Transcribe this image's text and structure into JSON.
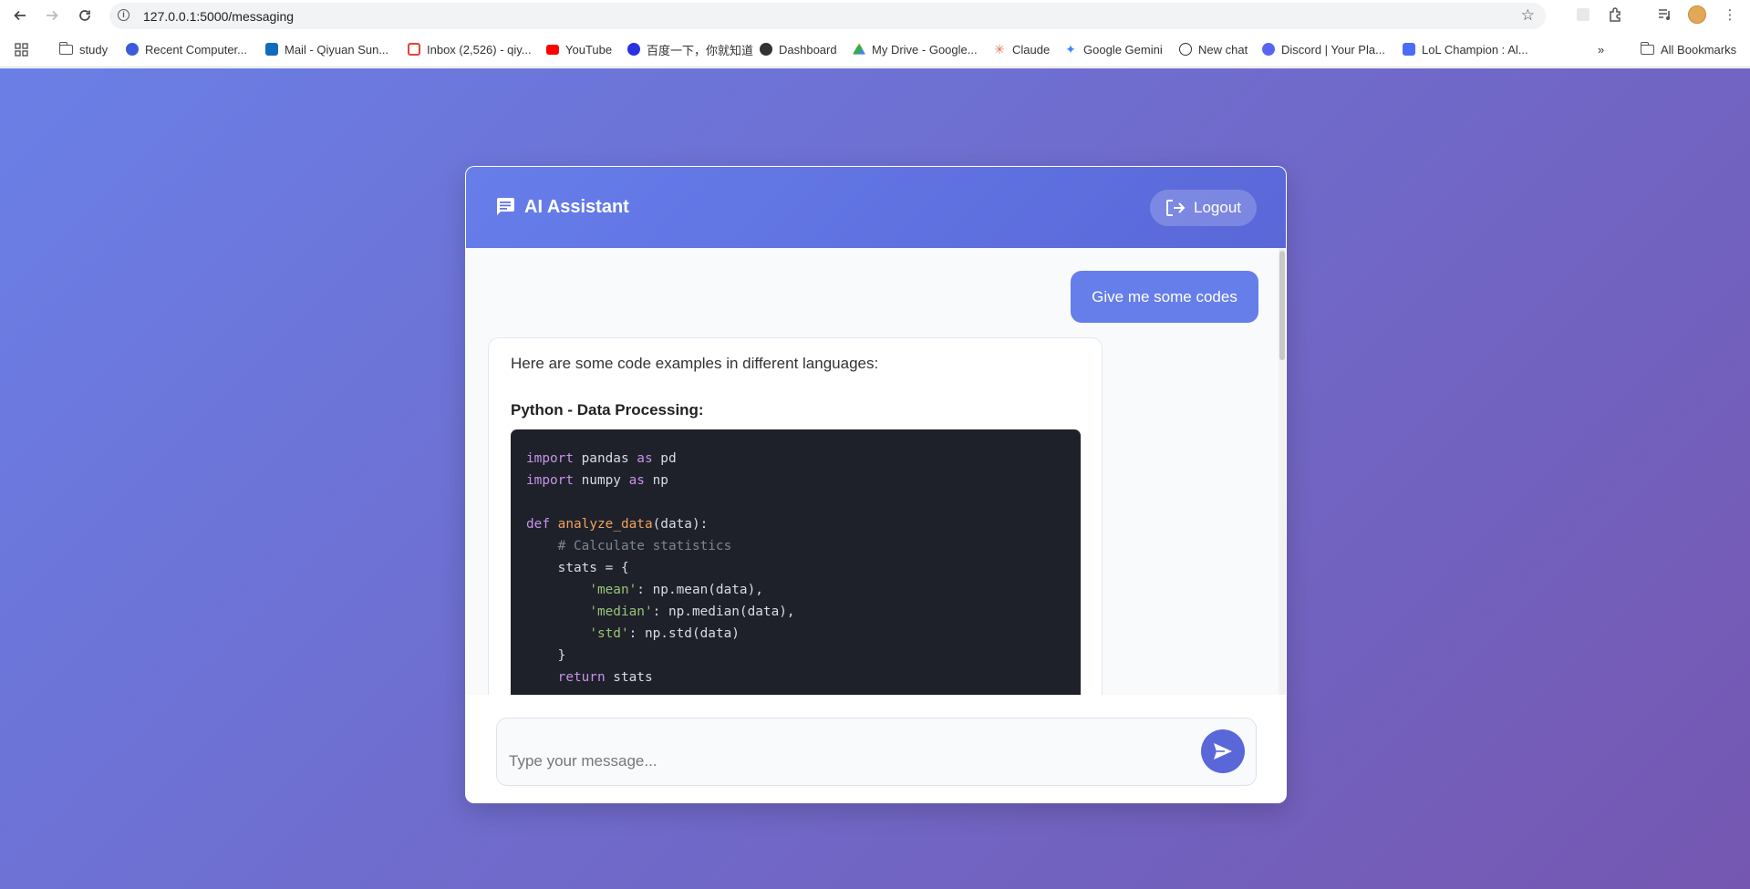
{
  "browser": {
    "url": "127.0.0.1:5000/messaging",
    "bookmarks": [
      {
        "label": "study",
        "icon": "folder-icon"
      },
      {
        "label": "Recent Computer...",
        "icon": "site-icon",
        "color": "#3b5bdb"
      },
      {
        "label": "Mail - Qiyuan Sun...",
        "icon": "outlook-icon",
        "color": "#0f6cbd"
      },
      {
        "label": "Inbox (2,526) - qiy...",
        "icon": "gmail-icon",
        "color": "#ea4335"
      },
      {
        "label": "YouTube",
        "icon": "youtube-icon",
        "color": "#ff0000"
      },
      {
        "label": "百度一下，你就知道",
        "icon": "baidu-icon",
        "color": "#2932e1"
      },
      {
        "label": "Dashboard",
        "icon": "dashboard-icon",
        "color": "#333333"
      },
      {
        "label": "My Drive - Google...",
        "icon": "drive-icon",
        "color": "#34a853"
      },
      {
        "label": "Claude",
        "icon": "claude-icon",
        "color": "#d97757"
      },
      {
        "label": "Google Gemini",
        "icon": "gemini-icon",
        "color": "#4285f4"
      },
      {
        "label": "New chat",
        "icon": "openai-icon",
        "color": "#333333"
      },
      {
        "label": "Discord | Your Pla...",
        "icon": "discord-icon",
        "color": "#5865f2"
      },
      {
        "label": "LoL Champion : Al...",
        "icon": "lol-icon",
        "color": "#4a6cf7"
      }
    ],
    "all_bookmarks": "All Bookmarks"
  },
  "chat": {
    "title": "AI Assistant",
    "logout_label": "Logout",
    "user_message": "Give me some codes",
    "bot_intro": "Here are some code examples in different languages:",
    "bot_heading": "Python - Data Processing:",
    "input_placeholder": "Type your message..."
  },
  "colors": {
    "accent": "#667eea",
    "gradient_end": "#764ba2",
    "code_bg": "#1e2129"
  }
}
